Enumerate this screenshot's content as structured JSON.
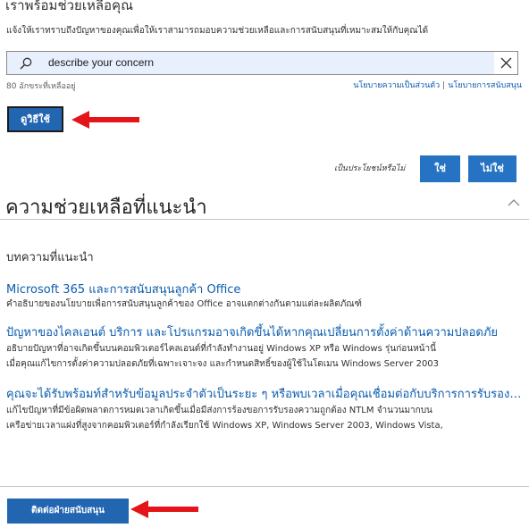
{
  "header": {
    "title": "เราพร้อมช่วยเหลือคุณ",
    "subtitle": "แจ้งให้เราทราบถึงปัญหาของคุณเพื่อให้เราสามารถมอบความช่วยเหลือและการสนับสนุนที่เหมาะสมให้กับคุณได้"
  },
  "search": {
    "value": "describe your concern",
    "icon": "search-icon",
    "clear_icon": "close-icon",
    "field_bg": "#e8f0fe"
  },
  "counter": "80 อักขระที่เหลืออยู่",
  "links": {
    "privacy": "นโยบายความเป็นส่วนตัว",
    "separator": "|",
    "support_policy": "นโยบายการสนับสนุน"
  },
  "solution_button": {
    "label": "ดูวิธีใช้"
  },
  "feedback": {
    "question": "เป็นประโยชน์หรือไม่",
    "yes": "ใช่",
    "no": "ไม่ใช่"
  },
  "section": {
    "title": "ความช่วยเหลือที่แนะนำ",
    "collapse_icon": "chevron-up-icon",
    "subheading": "บทความที่แนะนำ"
  },
  "articles": [
    {
      "title": "Microsoft 365 และการสนับสนุนลูกค้า Office",
      "lines": [
        "คำอธิบายของนโยบายเพื่อการสนับสนุนลูกค้าของ Office อาจแตกต่างกันตามแต่ละผลิตภัณฑ์"
      ]
    },
    {
      "title": "ปัญหาของไคลเอนต์ บริการ และโปรแกรมอาจเกิดขึ้นได้หากคุณเปลี่ยนการตั้งค่าด้านความปลอดภัย",
      "lines": [
        "อธิบายปัญหาที่อาจเกิดขึ้นบนคอมพิวเตอร์ไคลเอนต์ที่กำลังทำงานอยู่ Windows XP หรือ Windows รุ่นก่อนหน้านี้",
        "เมื่อคุณแก้ไขการตั้งค่าความปลอดภัยที่เฉพาะเจาะจง และกำหนดสิทธิ์ของผู้ใช้ในโดเมน Windows Server 2003"
      ]
    },
    {
      "title": "คุณจะได้รับพร้อมท์สำหรับข้อมูลประจำตัวเป็นระยะ ๆ หรือพบเวลาเมื่อคุณเชื่อมต่อกับบริการการรับรองความถูกต้อง",
      "lines": [
        "แก้ไขปัญหาที่มีข้อผิดพลาดการหมดเวลาเกิดขึ้นเมื่อมีส่งการร้องขอการรับรองความถูกต้อง NTLM จำนวนมากบน",
        "เครือข่ายเวลาแฝงที่สูงจากคอมพิวเตอร์ที่กำลังเรียกใช้ Windows XP, Windows Server 2003, Windows Vista,"
      ]
    }
  ],
  "contact_button": {
    "label": "ติดต่อฝ่ายสนับสนุน"
  },
  "colors": {
    "accent": "#2266b1",
    "link": "#0b5cad",
    "arrow": "#e3151a"
  }
}
